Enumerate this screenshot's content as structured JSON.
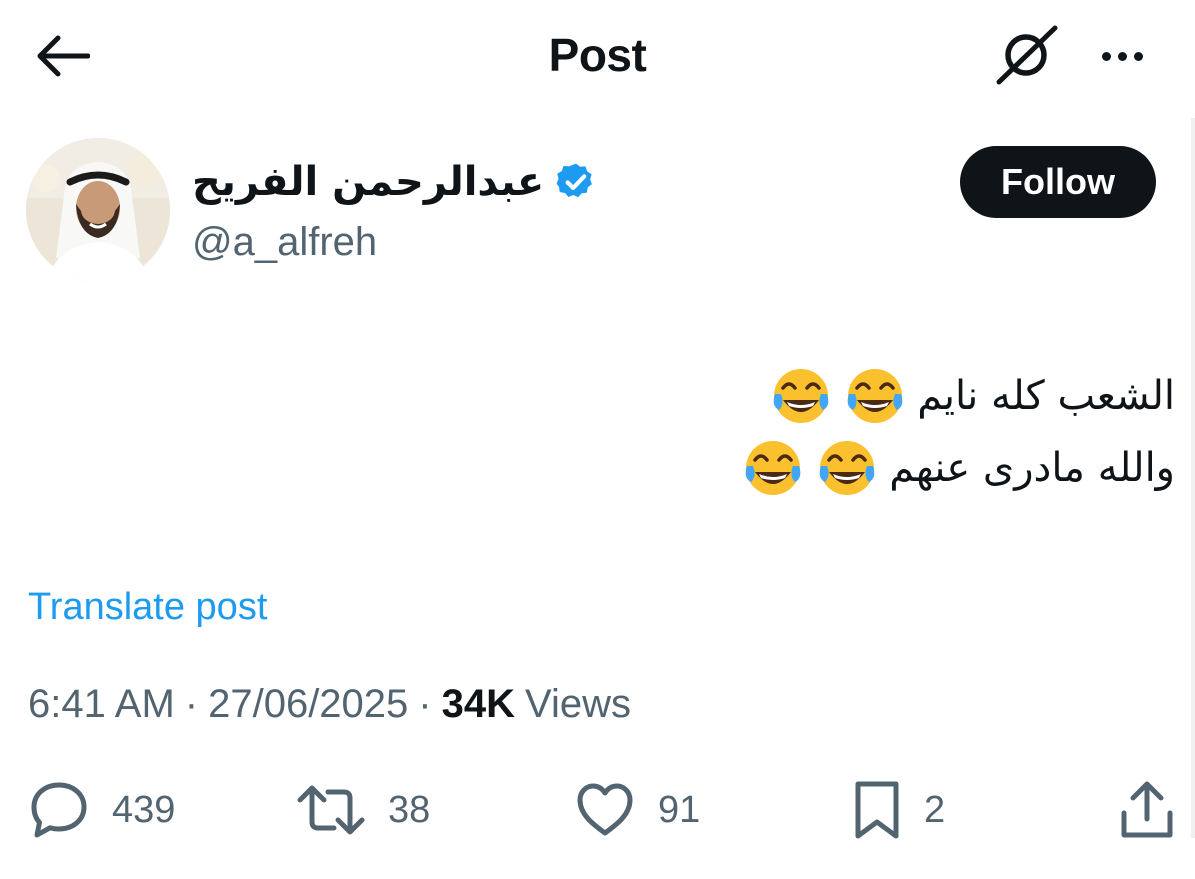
{
  "header": {
    "title": "Post",
    "back_icon": "back-arrow-icon",
    "grok_icon": "grok-icon",
    "more_icon": "more-options-icon"
  },
  "author": {
    "display_name": "عبدالرحمن الفريح",
    "handle": "@a_alfreh",
    "verified": true,
    "verified_color": "#1d9bf0"
  },
  "follow_button": {
    "label": "Follow"
  },
  "post": {
    "lines": [
      {
        "text": "الشعب كله نايم",
        "emoji": [
          "face-with-tears-of-joy",
          "face-with-tears-of-joy"
        ]
      },
      {
        "text": "والله مادرى عنهم",
        "emoji": [
          "face-with-tears-of-joy",
          "face-with-tears-of-joy"
        ]
      }
    ],
    "translate_label": "Translate post"
  },
  "meta": {
    "time": "6:41 AM",
    "separator": "·",
    "date": "27/06/2025",
    "views_count": "34K",
    "views_label": "Views"
  },
  "actions": {
    "replies": {
      "icon": "reply-icon",
      "count": "439"
    },
    "reposts": {
      "icon": "repost-icon",
      "count": "38"
    },
    "likes": {
      "icon": "like-icon",
      "count": "91"
    },
    "bookmarks": {
      "icon": "bookmark-icon",
      "count": "2"
    },
    "share": {
      "icon": "share-icon"
    }
  },
  "colors": {
    "text": "#0f1419",
    "secondary": "#536471",
    "link": "#1d9bf0",
    "follow_bg": "#0f1419"
  }
}
